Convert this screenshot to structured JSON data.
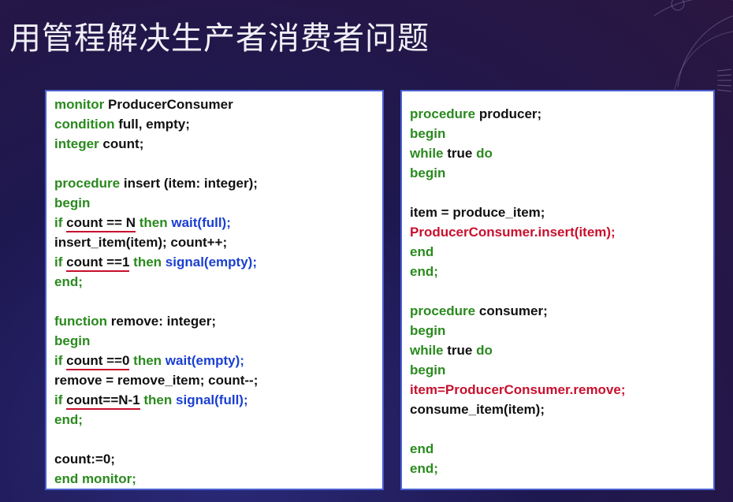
{
  "title": "用管程解决生产者消费者问题",
  "left_code": {
    "l1": [
      "monitor",
      "ProducerConsumer"
    ],
    "l2": [
      "condition",
      "full, empty;"
    ],
    "l3": [
      "integer",
      "count;"
    ],
    "l5": [
      "procedure",
      "insert (item: integer);"
    ],
    "l6": "begin",
    "l7": [
      "if",
      "count == N",
      "then",
      "wait(full);"
    ],
    "l8": "insert_item(item); count++;",
    "l9": [
      "if",
      "count ==1",
      "then",
      "signal(empty);"
    ],
    "l10": "end;",
    "l12": [
      "function",
      "remove: integer;"
    ],
    "l13": "begin",
    "l14": [
      "if",
      "count ==0",
      "then",
      "wait(empty);"
    ],
    "l15": "remove = remove_item; count--;",
    "l16": [
      "if",
      "count==N-1",
      "then",
      "signal(full);"
    ],
    "l17": "end;",
    "l19": "count:=0;",
    "l20": "end monitor;"
  },
  "right_code": {
    "r1": [
      "procedure",
      "producer;"
    ],
    "r2": "begin",
    "r3": [
      "while",
      "true",
      "do"
    ],
    "r4": "begin",
    "r6": "item = produce_item;",
    "r7": "ProducerConsumer.insert(item);",
    "r8": "end",
    "r9": "end;",
    "r11": [
      "procedure",
      "consumer;"
    ],
    "r12": "begin",
    "r13": [
      "while",
      "true",
      "do"
    ],
    "r14": "begin",
    "r15": "item=ProducerConsumer.remove;",
    "r16": "consume_item(item);",
    "r18": "end",
    "r19": "end;"
  }
}
